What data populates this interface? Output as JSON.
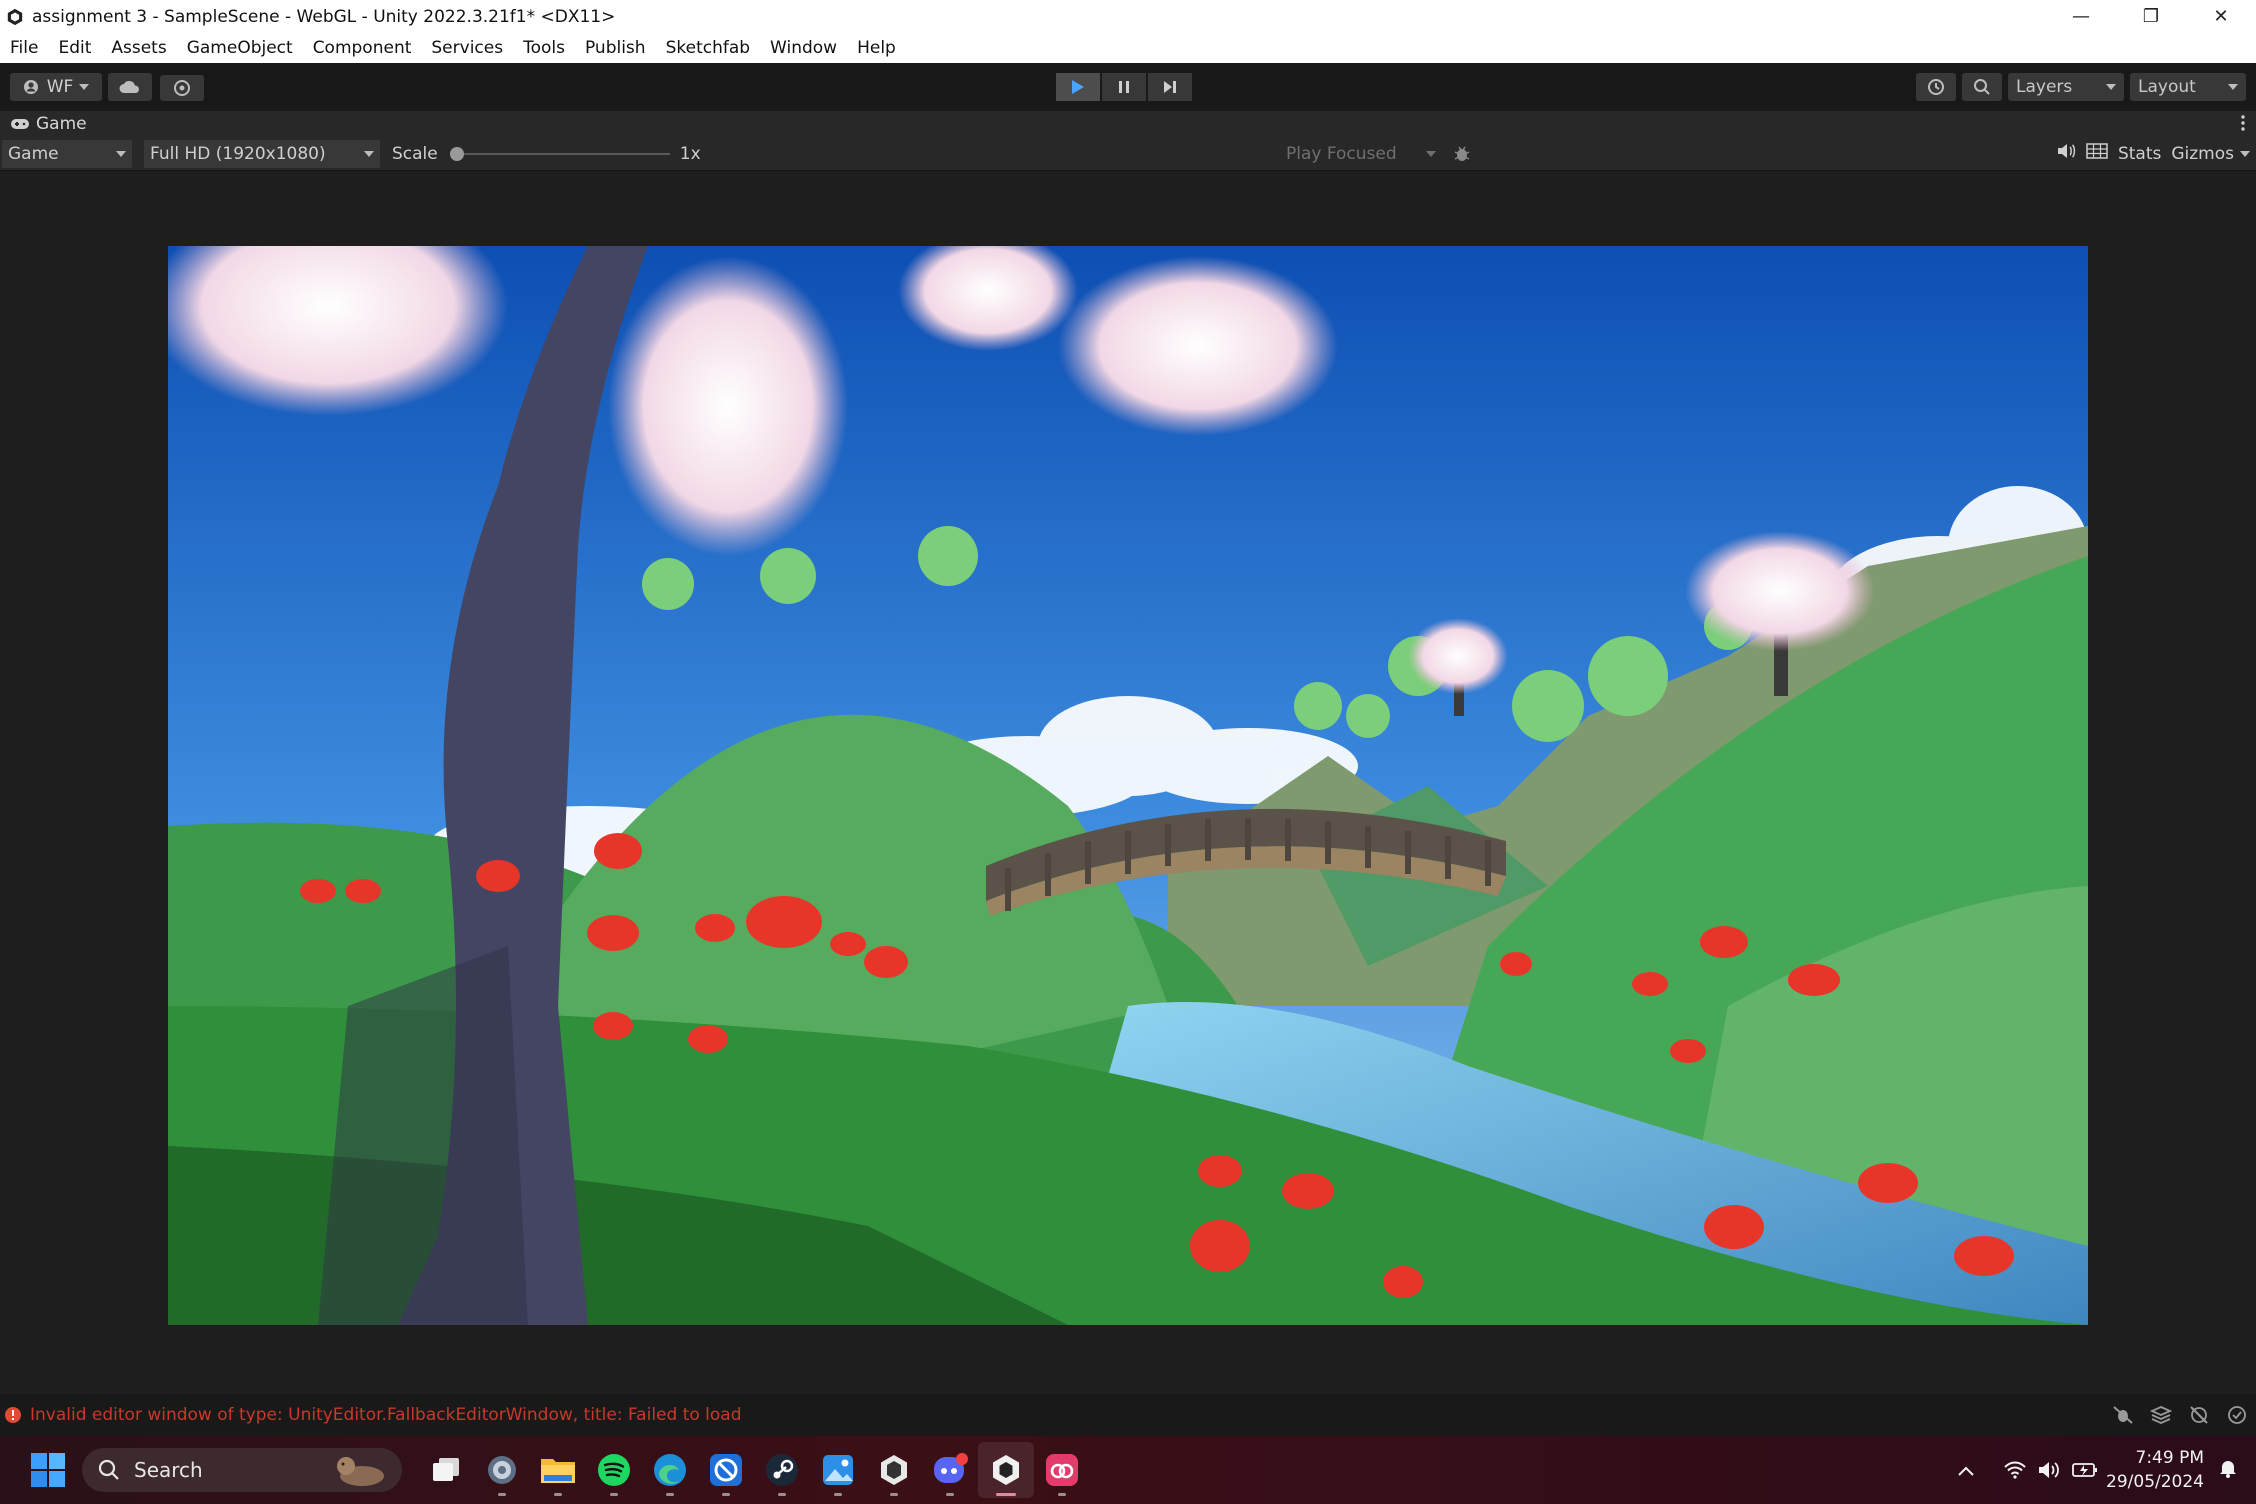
{
  "window": {
    "title": "assignment 3 - SampleScene - WebGL - Unity 2022.3.21f1* <DX11>",
    "minimize_glyph": "—",
    "maximize_glyph": "❐",
    "close_glyph": "✕"
  },
  "menu": [
    "File",
    "Edit",
    "Assets",
    "GameObject",
    "Component",
    "Services",
    "Tools",
    "Publish",
    "Sketchfab",
    "Window",
    "Help"
  ],
  "toolbar": {
    "account_label": "WF",
    "layers_label": "Layers",
    "layout_label": "Layout"
  },
  "tab": {
    "label": "Game"
  },
  "gamebar": {
    "display_select": "Game",
    "resolution_select": "Full HD (1920x1080)",
    "scale_label": "Scale",
    "scale_value": "1x",
    "scale_level": 0,
    "play_mode_select": "Play Focused",
    "stats_label": "Stats",
    "gizmos_label": "Gizmos"
  },
  "status": {
    "error_message": "Invalid editor window of type: UnityEditor.FallbackEditorWindow, title: Failed to load",
    "error_color": "#d23a2a"
  },
  "taskbar": {
    "search_placeholder": "Search",
    "time": "7:49 PM",
    "date": "29/05/2024",
    "apps": [
      "windows-start",
      "task-view",
      "settings",
      "file-explorer",
      "spotify",
      "edge",
      "snipping-tool",
      "steam",
      "photos",
      "unity-hub",
      "discord",
      "unity",
      "creative-cloud"
    ]
  }
}
